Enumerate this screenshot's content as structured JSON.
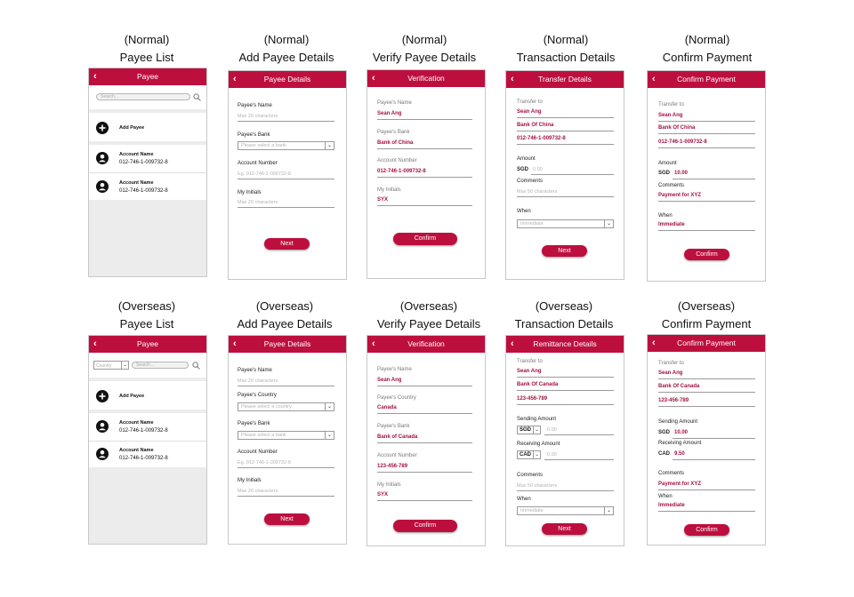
{
  "colors": {
    "brand": "#bd0f3e",
    "value_text": "#a3123f",
    "pane_gray": "#ececec"
  },
  "captions": {
    "n1": {
      "variant": "(Normal)",
      "screen": "Payee List"
    },
    "n2": {
      "variant": "(Normal)",
      "screen": "Add Payee Details"
    },
    "n3": {
      "variant": "(Normal)",
      "screen": "Verify Payee Details"
    },
    "n4": {
      "variant": "(Normal)",
      "screen": "Transaction Details"
    },
    "n5": {
      "variant": "(Normal)",
      "screen": "Confirm Payment"
    },
    "o1": {
      "variant": "(Overseas)",
      "screen": "Payee List"
    },
    "o2": {
      "variant": "(Overseas)",
      "screen": "Add Payee Details"
    },
    "o3": {
      "variant": "(Overseas)",
      "screen": "Verify Payee Details"
    },
    "o4": {
      "variant": "(Overseas)",
      "screen": "Transaction Details"
    },
    "o5": {
      "variant": "(Overseas)",
      "screen": "Confirm Payment"
    }
  },
  "back_glyph": "‹",
  "n_payee_list": {
    "title": "Payee",
    "search_placeholder": "Search...",
    "add_payee": "Add Payee",
    "accounts": [
      {
        "name": "Account Name",
        "number": "012-746-1-009732-8"
      },
      {
        "name": "Account Name",
        "number": "012-746-1-009732-8"
      }
    ]
  },
  "n_add_payee": {
    "title": "Payee Details",
    "name_label": "Payee's Name",
    "name_placeholder": "Max 20 characters",
    "bank_label": "Payee's Bank",
    "bank_placeholder": "Please select a bank",
    "account_label": "Account Number",
    "account_placeholder": "Eg. 012-746-1-009732-8",
    "initials_label": "My Initials",
    "initials_placeholder": "Max 20 characters",
    "next": "Next"
  },
  "n_verify": {
    "title": "Verification",
    "name_label": "Payee's Name",
    "name_value": "Sean Ang",
    "bank_label": "Payee's Bank",
    "bank_value": "Bank of China",
    "account_label": "Account Number",
    "account_value": "012-746-1-009732-8",
    "initials_label": "My Initials",
    "initials_value": "SYX",
    "confirm": "Confirm"
  },
  "n_transfer": {
    "title": "Transfer Details",
    "transfer_to": "Transfer to",
    "payee": "Sean Ang",
    "bank": "Bank Of China",
    "account": "012-746-1-009732-8",
    "amount_label": "Amount",
    "currency": "SGD",
    "amount_placeholder": "0.00",
    "comments_label": "Comments",
    "comments_placeholder": "Max 50 characters",
    "when_label": "When",
    "when_placeholder": "Immediate",
    "next": "Next"
  },
  "n_confirm": {
    "title": "Confirm Payment",
    "transfer_to": "Transfer to",
    "payee": "Sean Ang",
    "bank": "Bank Of China",
    "account": "012-746-1-009732-8",
    "amount_label": "Amount",
    "currency": "SGD",
    "amount": "10.00",
    "comments_label": "Comments",
    "comments": "Payment for XYZ",
    "when_label": "When",
    "when": "Immediate",
    "confirm": "Confirm"
  },
  "o_payee_list": {
    "title": "Payee",
    "country_placeholder": "Country",
    "search_placeholder": "Search...",
    "add_payee": "Add Payee",
    "accounts": [
      {
        "name": "Account Name",
        "number": "012-746-1-009732-8"
      },
      {
        "name": "Account Name",
        "number": "012-746-1-009732-8"
      }
    ]
  },
  "o_add_payee": {
    "title": "Payee Details",
    "name_label": "Payee's Name",
    "name_placeholder": "Max 20 characters",
    "country_label": "Payee's Country",
    "country_placeholder": "Please select a country",
    "bank_label": "Payee's Bank",
    "bank_placeholder": "Please select a bank",
    "account_label": "Account Number",
    "account_placeholder": "Eg. 012-746-1-009732-8",
    "initials_label": "My Initials",
    "initials_placeholder": "Max 20 characters",
    "next": "Next"
  },
  "o_verify": {
    "title": "Verification",
    "name_label": "Payee's Name",
    "name_value": "Sean Ang",
    "country_label": "Payee's Country",
    "country_value": "Canada",
    "bank_label": "Payee's Bank",
    "bank_value": "Bank of Canada",
    "account_label": "Account Number",
    "account_value": "123-456-789",
    "initials_label": "My Initials",
    "initials_value": "SYX",
    "confirm": "Confirm"
  },
  "o_remit": {
    "title": "Remittance Details",
    "transfer_to": "Transfer to",
    "payee": "Sean Ang",
    "bank": "Bank Of Canada",
    "account": "123-456-789",
    "sending_label": "Sending Amount",
    "sending_currency": "SGD",
    "sending_placeholder": "0.00",
    "receiving_label": "Receiving Amount",
    "receiving_currency": "CAD",
    "receiving_placeholder": "0.00",
    "comments_label": "Comments",
    "comments_placeholder": "Max 50 characters",
    "when_label": "When",
    "when_placeholder": "Immediate",
    "next": "Next"
  },
  "o_confirm": {
    "title": "Confirm Payment",
    "transfer_to": "Transfer to",
    "payee": "Sean Ang",
    "bank": "Bank Of Canada",
    "account": "123-456-789",
    "sending_label": "Sending Amount",
    "sending_currency": "SGD",
    "sending_amount": "10.00",
    "receiving_label": "Receiving Amount",
    "receiving_currency": "CAD",
    "receiving_amount": "9.50",
    "comments_label": "Comments",
    "comments": "Payment for XYZ",
    "when_label": "When",
    "when": "Immediate",
    "confirm": "Confirm"
  }
}
